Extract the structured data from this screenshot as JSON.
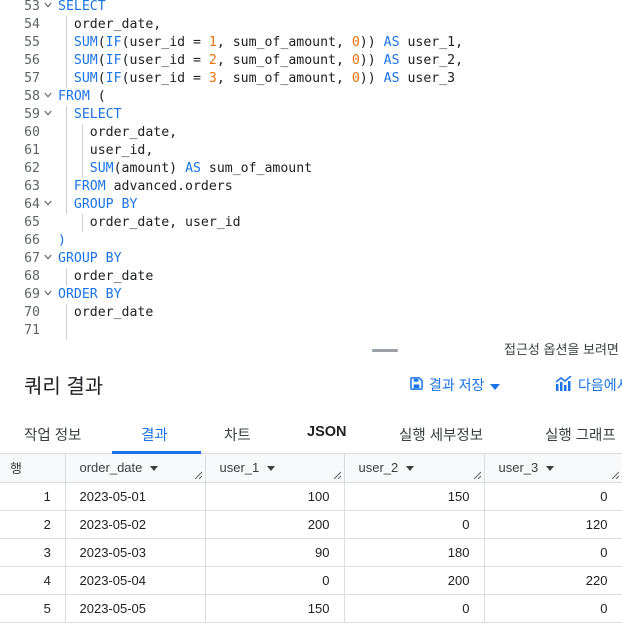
{
  "editor": {
    "lines": [
      {
        "n": "53",
        "fold": true,
        "tokens": [
          {
            "t": "SELECT",
            "c": "k"
          }
        ]
      },
      {
        "n": "54",
        "fold": false,
        "tokens": [
          {
            "t": "  order_date,",
            "c": ""
          }
        ]
      },
      {
        "n": "55",
        "fold": false,
        "tokens": [
          {
            "t": "  ",
            "c": ""
          },
          {
            "t": "SUM",
            "c": "k"
          },
          {
            "t": "(",
            "c": ""
          },
          {
            "t": "IF",
            "c": "k"
          },
          {
            "t": "(user_id = ",
            "c": ""
          },
          {
            "t": "1",
            "c": "n"
          },
          {
            "t": ", sum_of_amount, ",
            "c": ""
          },
          {
            "t": "0",
            "c": "n"
          },
          {
            "t": ")) ",
            "c": ""
          },
          {
            "t": "AS",
            "c": "k"
          },
          {
            "t": " user_1,",
            "c": ""
          }
        ]
      },
      {
        "n": "56",
        "fold": false,
        "tokens": [
          {
            "t": "  ",
            "c": ""
          },
          {
            "t": "SUM",
            "c": "k"
          },
          {
            "t": "(",
            "c": ""
          },
          {
            "t": "IF",
            "c": "k"
          },
          {
            "t": "(user_id = ",
            "c": ""
          },
          {
            "t": "2",
            "c": "n"
          },
          {
            "t": ", sum_of_amount, ",
            "c": ""
          },
          {
            "t": "0",
            "c": "n"
          },
          {
            "t": ")) ",
            "c": ""
          },
          {
            "t": "AS",
            "c": "k"
          },
          {
            "t": " user_2,",
            "c": ""
          }
        ]
      },
      {
        "n": "57",
        "fold": false,
        "tokens": [
          {
            "t": "  ",
            "c": ""
          },
          {
            "t": "SUM",
            "c": "k"
          },
          {
            "t": "(",
            "c": ""
          },
          {
            "t": "IF",
            "c": "k"
          },
          {
            "t": "(user_id = ",
            "c": ""
          },
          {
            "t": "3",
            "c": "n"
          },
          {
            "t": ", sum_of_amount, ",
            "c": ""
          },
          {
            "t": "0",
            "c": "n"
          },
          {
            "t": ")) ",
            "c": ""
          },
          {
            "t": "AS",
            "c": "k"
          },
          {
            "t": " user_3",
            "c": ""
          }
        ]
      },
      {
        "n": "58",
        "fold": true,
        "tokens": [
          {
            "t": "FROM",
            "c": "k"
          },
          {
            "t": " (",
            "c": ""
          }
        ]
      },
      {
        "n": "59",
        "fold": true,
        "tokens": [
          {
            "t": "  ",
            "c": ""
          },
          {
            "t": "SELECT",
            "c": "k"
          }
        ]
      },
      {
        "n": "60",
        "fold": false,
        "tokens": [
          {
            "t": "    order_date,",
            "c": ""
          }
        ]
      },
      {
        "n": "61",
        "fold": false,
        "tokens": [
          {
            "t": "    user_id,",
            "c": ""
          }
        ]
      },
      {
        "n": "62",
        "fold": false,
        "tokens": [
          {
            "t": "    ",
            "c": ""
          },
          {
            "t": "SUM",
            "c": "k"
          },
          {
            "t": "(amount) ",
            "c": ""
          },
          {
            "t": "AS",
            "c": "k"
          },
          {
            "t": " sum_of_amount",
            "c": ""
          }
        ]
      },
      {
        "n": "63",
        "fold": false,
        "tokens": [
          {
            "t": "  ",
            "c": ""
          },
          {
            "t": "FROM",
            "c": "k"
          },
          {
            "t": " advanced.orders",
            "c": ""
          }
        ]
      },
      {
        "n": "64",
        "fold": true,
        "tokens": [
          {
            "t": "  ",
            "c": ""
          },
          {
            "t": "GROUP BY",
            "c": "k"
          }
        ]
      },
      {
        "n": "65",
        "fold": false,
        "tokens": [
          {
            "t": "    order_date, user_id",
            "c": ""
          }
        ]
      },
      {
        "n": "66",
        "fold": false,
        "tokens": [
          {
            "t": ")",
            "c": "k"
          }
        ]
      },
      {
        "n": "67",
        "fold": true,
        "tokens": [
          {
            "t": "GROUP BY",
            "c": "k"
          }
        ]
      },
      {
        "n": "68",
        "fold": false,
        "tokens": [
          {
            "t": "  order_date",
            "c": ""
          }
        ]
      },
      {
        "n": "69",
        "fold": true,
        "tokens": [
          {
            "t": "ORDER BY",
            "c": "k"
          }
        ]
      },
      {
        "n": "70",
        "fold": false,
        "tokens": [
          {
            "t": "  order_date",
            "c": ""
          }
        ]
      },
      {
        "n": "71",
        "fold": false,
        "tokens": []
      }
    ],
    "accessibility_hint": "접근성 옵션을 보려면"
  },
  "results": {
    "title": "쿼리 결과",
    "save_label": "결과 저장",
    "explore_label": "다음에서"
  },
  "tabs": [
    {
      "label": "작업 정보",
      "active": false,
      "bold": false
    },
    {
      "label": "결과",
      "active": true,
      "bold": false
    },
    {
      "label": "차트",
      "active": false,
      "bold": false
    },
    {
      "label": "JSON",
      "active": false,
      "bold": true
    },
    {
      "label": "실행 세부정보",
      "active": false,
      "bold": false
    },
    {
      "label": "실행 그래프",
      "active": false,
      "bold": false
    }
  ],
  "table": {
    "row_header": "행",
    "columns": [
      "order_date",
      "user_1",
      "user_2",
      "user_3"
    ],
    "rows": [
      [
        "1",
        "2023-05-01",
        "100",
        "150",
        "0"
      ],
      [
        "2",
        "2023-05-02",
        "200",
        "0",
        "120"
      ],
      [
        "3",
        "2023-05-03",
        "90",
        "180",
        "0"
      ],
      [
        "4",
        "2023-05-04",
        "0",
        "200",
        "220"
      ],
      [
        "5",
        "2023-05-05",
        "150",
        "0",
        "0"
      ]
    ]
  },
  "colors": {
    "keyword": "#1a73e8",
    "number": "#e8710a",
    "accent": "#1a73e8"
  },
  "icons": {
    "fold": "chevron-down-icon",
    "save": "save-icon",
    "explore": "chart-icon",
    "sort": "sort-dropdown-icon",
    "resize": "column-resize-icon"
  }
}
